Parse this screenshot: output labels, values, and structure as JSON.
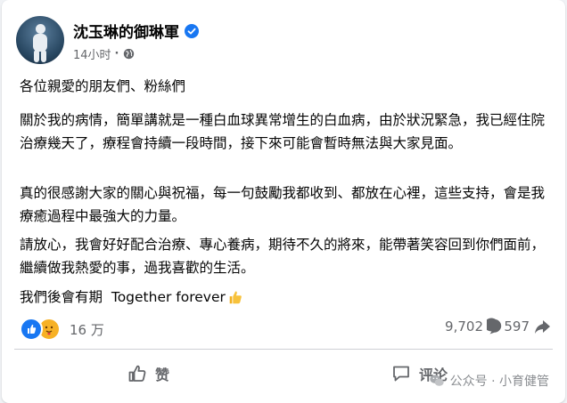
{
  "post": {
    "author": "沈玉琳的御琳軍",
    "timestamp": "14小时",
    "meta_separator": "·",
    "verified_icon": "verified-badge-icon",
    "privacy_icon": "globe-icon",
    "greeting": "各位親愛的朋友們、粉絲們",
    "paragraphs": [
      "關於我的病情，簡單講就是一種白血球異常增生的白血病，由於狀況緊急，我已經住院治療幾天了，療程會持續一段時間，接下來可能會暫時無法與大家見面。",
      "真的很感謝大家的關心與祝福，每一句鼓勵我都收到、都放在心裡，這些支持，會是我療癒過程中最強大的力量。",
      "請放心，我會好好配合治療、專心養病，期待不久的將來，能帶著笑容回到你們面前，繼續做我熱愛的事，過我喜歡的生活。"
    ],
    "closing": "我們後會有期  Together forever"
  },
  "stats": {
    "reaction_count": "16 万",
    "comment_count": "9,702",
    "share_count": "597"
  },
  "actions": {
    "like_label": "赞",
    "comment_label": "评论"
  },
  "watermark": {
    "text": "公众号 · 小育健管"
  },
  "colors": {
    "link_blue": "#1877f2",
    "secondary_text": "#65676b",
    "divider": "#ced0d4"
  }
}
